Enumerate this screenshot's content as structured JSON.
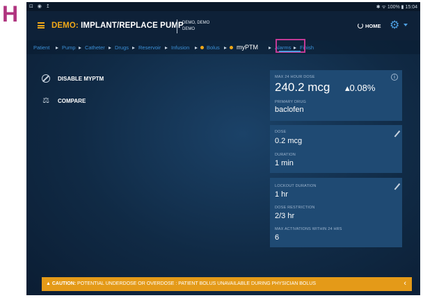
{
  "panel_letter": "H",
  "status_bar": {
    "left_icons": "⊡ ◉ ↥",
    "right_text": "✱ ᯤ 100% ▮ 15:04"
  },
  "app": {
    "title_prefix": "DEMO:",
    "title": " IMPLANT/REPLACE PUMP",
    "patient_line1": "DEMO, DEMO",
    "patient_line2": "DEMO",
    "home_label": "HOME"
  },
  "breadcrumb": [
    "Patient",
    "Pump",
    "Catheter",
    "Drugs",
    "Reservoir",
    "Infusion",
    "Bolus",
    "myPTM",
    "Alarms",
    "Finish"
  ],
  "actions": {
    "disable": "DISABLE MYPTM",
    "compare": "COMPARE"
  },
  "cards": {
    "max24": {
      "label": "MAX 24 HOUR DOSE",
      "value": "240.2 mcg",
      "change": "▴0.08%",
      "drug_label": "PRIMARY DRUG",
      "drug": "baclofen"
    },
    "dose": {
      "dose_label": "DOSE",
      "dose": "0.2 mcg",
      "duration_label": "DURATION",
      "duration": "1 min"
    },
    "lockout": {
      "lockout_label": "LOCKOUT DURATION",
      "lockout": "1 hr",
      "restriction_label": "DOSE RESTRICTION",
      "restriction": "2/3 hr",
      "max_label": "MAX ACTIVATIONS WITHIN 24 HRS",
      "max": "6"
    }
  },
  "caution": {
    "prefix": "▲ CAUTION:",
    "text": " POTENTIAL UNDERDOSE OR OVERDOSE : PATIENT BOLUS UNAVAILABLE DURING PHYSICIAN BOLUS"
  },
  "colors": {
    "accent": "#f0a818",
    "link": "#3b8fd6",
    "highlight": "#c23a95",
    "card": "#1f4a73"
  }
}
